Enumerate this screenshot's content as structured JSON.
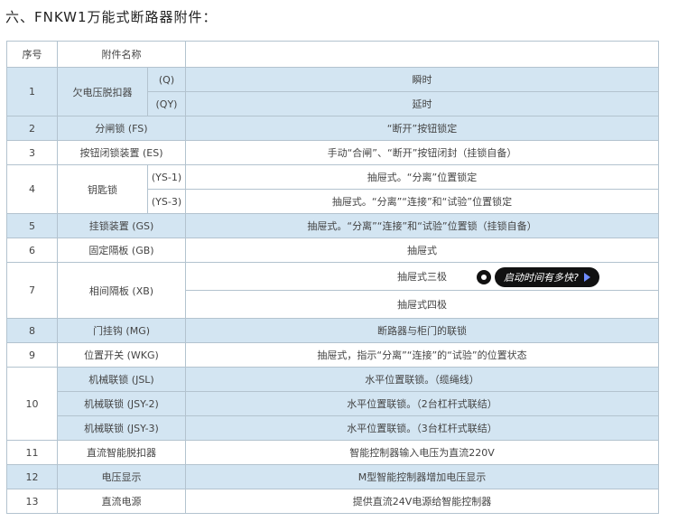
{
  "heading": "六、FNKW1万能式断路器附件：",
  "table": {
    "header": {
      "no": "序号",
      "name": "附件名称"
    },
    "rows": {
      "r1": {
        "no": "1",
        "name": "欠电压脱扣器",
        "sub1": "(Q)",
        "desc1": "瞬时",
        "sub2": "(QY)",
        "desc2": "延时"
      },
      "r2": {
        "no": "2",
        "name": "分闸锁 (FS)",
        "desc": "“断开”按钮锁定"
      },
      "r3": {
        "no": "3",
        "name": "按钮闭锁装置 (ES)",
        "desc": "手动“合闸”、“断开”按钮闭封（挂锁自备）"
      },
      "r4": {
        "no": "4",
        "name": "钥匙锁",
        "sub1": "(YS-1)",
        "desc1": "抽屉式。“分离”位置锁定",
        "sub2": "(YS-3)",
        "desc2": "抽屉式。“分离”“连接”和“试验”位置锁定"
      },
      "r5": {
        "no": "5",
        "name": "挂锁装置 (GS)",
        "desc": "抽屉式。“分离”“连接”和“试验”位置锁（挂锁自备）"
      },
      "r6": {
        "no": "6",
        "name": "固定隔板 (GB)",
        "desc": "抽屉式"
      },
      "r7": {
        "no": "7",
        "name": "相间隔板 (XB)",
        "desc1": "抽屉式三极",
        "desc2": "抽屉式四极"
      },
      "r8": {
        "no": "8",
        "name": "门挂钩 (MG)",
        "desc": "断路器与柜门的联锁"
      },
      "r9": {
        "no": "9",
        "name": "位置开关 (WKG)",
        "desc": "抽屉式，指示“分离”“连接”的“试验”的位置状态"
      },
      "r10": {
        "no": "10",
        "name1": "机械联锁 (JSL)",
        "desc1": "水平位置联锁。（缆绳线）",
        "name2": "机械联锁 (JSY-2)",
        "desc2": "水平位置联锁。（2台杠杆式联结）",
        "name3": "机械联锁 (JSY-3)",
        "desc3": "水平位置联锁。（3台杠杆式联结）"
      },
      "r11": {
        "no": "11",
        "name": "直流智能脱扣器",
        "desc": "智能控制器输入电压为直流220V"
      },
      "r12": {
        "no": "12",
        "name": "电压显示",
        "desc": "M型智能控制器增加电压显示"
      },
      "r13": {
        "no": "13",
        "name": "直流电源",
        "desc": "提供直流24V电源给智能控制器"
      }
    }
  },
  "overlay": {
    "text": "启动时间有多快?",
    "icon": "play-arrow-icon"
  }
}
